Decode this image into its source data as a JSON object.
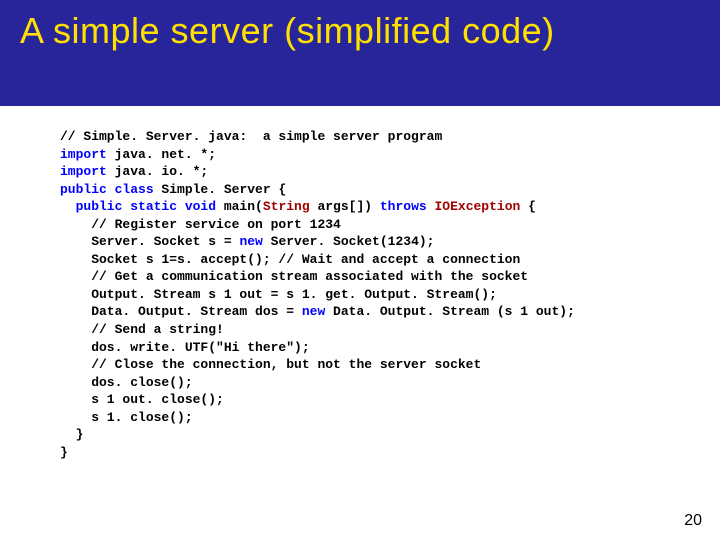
{
  "title": "A simple server (simplified code)",
  "page_number": "20",
  "code": {
    "l01": "// Simple. Server. java:  a simple server program",
    "l02a": "import",
    "l02b": " java. net. *;",
    "l03a": "import",
    "l03b": " java. io. *;",
    "l04a": "public class",
    "l04b": " Simple. Server {",
    "l05a": "  public static void",
    "l05b": " main(",
    "l05c": "String",
    "l05d": " args[]) ",
    "l05e": "throws ",
    "l05f": "IOException",
    "l05g": " {",
    "l06": "    // Register service on port 1234",
    "l07a": "    Server. Socket s = ",
    "l07b": "new",
    "l07c": " Server. Socket(1234);",
    "l08": "    Socket s 1=s. accept(); // Wait and accept a connection",
    "l09": "    // Get a communication stream associated with the socket",
    "l10": "    Output. Stream s 1 out = s 1. get. Output. Stream();",
    "l11a": "    Data. Output. Stream dos = ",
    "l11b": "new",
    "l11c": " Data. Output. Stream (s 1 out);",
    "l12": "    // Send a string!",
    "l13": "    dos. write. UTF(\"Hi there\");",
    "l14": "    // Close the connection, but not the server socket",
    "l15": "    dos. close();",
    "l16": "    s 1 out. close();",
    "l17": "    s 1. close();",
    "l18": "  }",
    "l19": "}"
  }
}
